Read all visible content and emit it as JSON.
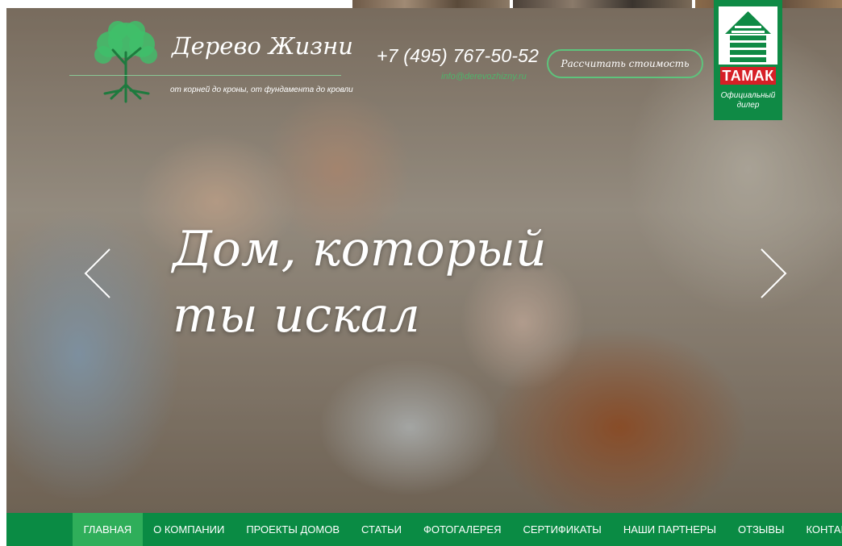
{
  "logo": {
    "title": "Дерево Жизни",
    "tagline": "от корней до кроны, от фундамента до кровли"
  },
  "contacts": {
    "phone": "+7 (495) 767-50-52",
    "email": "info@derevozhizny.ru"
  },
  "cta": {
    "calc_label": "Рассчитать стоимость"
  },
  "dealer": {
    "brand": "ТАМАК",
    "line1": "Официальный",
    "line2": "дилер"
  },
  "slider": {
    "slogan_line1": "Дом, который",
    "slogan_line2": "ты искал",
    "prev_icon": "chevron-left-icon",
    "next_icon": "chevron-right-icon"
  },
  "nav": {
    "items": [
      {
        "label": "ГЛАВНАЯ",
        "active": true
      },
      {
        "label": "О КОМПАНИИ"
      },
      {
        "label": "ПРОЕКТЫ ДОМОВ"
      },
      {
        "label": "СТАТЬИ"
      },
      {
        "label": "ФОТОГАЛЕРЕЯ"
      },
      {
        "label": "СЕРТИФИКАТЫ"
      },
      {
        "label": "НАШИ ПАРТНЕРЫ"
      },
      {
        "label": "ОТЗЫВЫ"
      },
      {
        "label": "КОНТАКТЫ"
      }
    ]
  },
  "colors": {
    "brand_green": "#0a8b44",
    "nav_active": "#2fae5a",
    "accent_green": "#5dc47c",
    "dealer_red": "#d61f26"
  }
}
